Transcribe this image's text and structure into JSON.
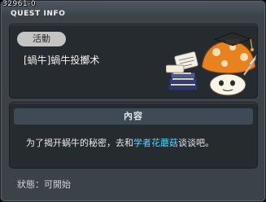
{
  "window": {
    "quest_id": "32961-0",
    "title": "QUEST INFO"
  },
  "quest": {
    "category": "活動",
    "name": "[蝸牛]蝸牛投擲术",
    "illustration_icon": "mushroom-scholar-with-books-icon"
  },
  "content": {
    "header": "內容",
    "description_before": "为了揭开蜗牛的秘密，去和",
    "npc_name": "学者花蘑菇",
    "description_after": "谈谈吧。",
    "npc_color": "#50d6ff"
  },
  "status": {
    "text": "狀態：可開始"
  }
}
